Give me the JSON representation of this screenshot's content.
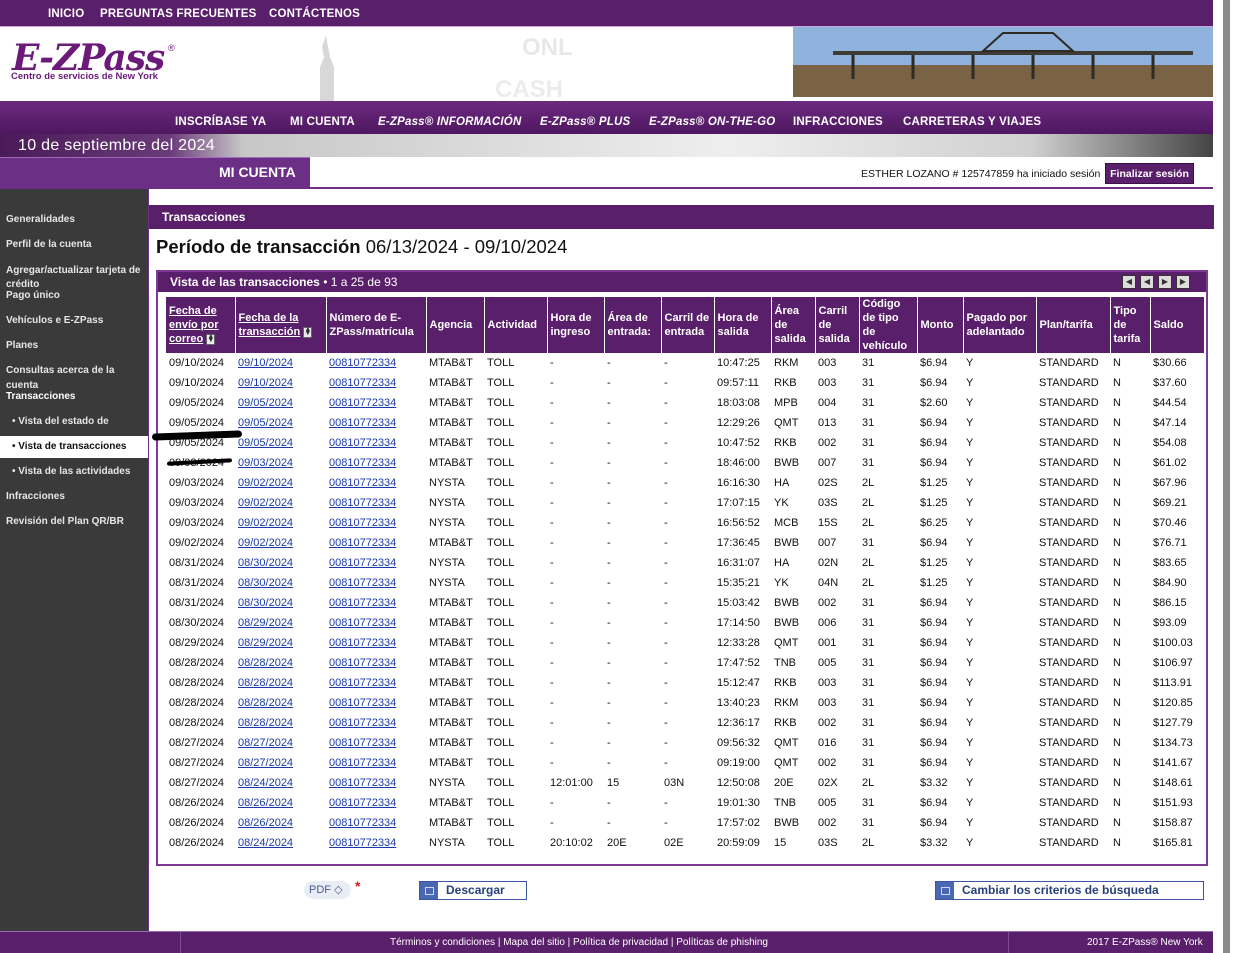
{
  "topnav": [
    "INICIO",
    "PREGUNTAS FRECUENTES",
    "CONTÁCTENOS"
  ],
  "logo": {
    "word": "E-ZPass",
    "reg": "®",
    "sub": "Centro de servicios de New York"
  },
  "mainnav": [
    "INSCRÍBASE YA",
    "MI CUENTA",
    "E-ZPass® INFORMACIÓN",
    "E-ZPass® PLUS",
    "E-ZPass® ON-THE-GO",
    "INFRACCIONES",
    "CARRETERAS Y VIAJES"
  ],
  "date": "10 de septiembre del 2024",
  "section_tab": "MI CUENTA",
  "user": {
    "line": "ESTHER LOZANO # 125747859 ha iniciado sesión",
    "logout": "Finalizar sesión"
  },
  "sidebar": {
    "generalidades": "Generalidades",
    "perfil": "Perfil de la cuenta",
    "tarjeta_1": "Agregar/actualizar tarjeta de",
    "tarjeta_2": "crédito",
    "pago": "Pago único",
    "vehiculos": "Vehículos e E-ZPass",
    "planes": "Planes",
    "consultas_1": "Consultas acerca de la",
    "consultas_2": "cuenta",
    "transacciones": "Transacciones",
    "estado": "• Vista del estado de",
    "vista_trans": "• Vista de transacciones",
    "actividades": "• Vista de las actividades",
    "infracciones": "Infracciones",
    "revision": "Revisión del Plan QR/BR"
  },
  "content": {
    "header": "Transacciones",
    "period_label": "Período de transacción",
    "period_range": "06/13/2024 - 09/10/2024",
    "panel_title": "Vista de las transacciones",
    "panel_range": "1 a 25 de 93"
  },
  "table": {
    "headers": [
      "Fecha de envío por correo",
      "Fecha de la transacción",
      "Número de E-ZPass/matrícula",
      "Agencia",
      "Actividad",
      "Hora de ingreso",
      "Área de entrada:",
      "Carril de entrada",
      "Hora de salida",
      "Área de salida",
      "Carril de salida",
      "Código de tipo de vehículo",
      "Monto",
      "Pagado por adelantado",
      "Plan/tarifa",
      "Tipo de tarifa",
      "Saldo"
    ],
    "rows": [
      [
        "09/10/2024",
        "09/10/2024",
        "00810772334",
        "MTAB&T",
        "TOLL",
        "-",
        "-",
        "-",
        "10:47:25",
        "RKM",
        "003",
        "31",
        "$6.94",
        "Y",
        "STANDARD",
        "N",
        "$30.66"
      ],
      [
        "09/10/2024",
        "09/10/2024",
        "00810772334",
        "MTAB&T",
        "TOLL",
        "-",
        "-",
        "-",
        "09:57:11",
        "RKB",
        "003",
        "31",
        "$6.94",
        "Y",
        "STANDARD",
        "N",
        "$37.60"
      ],
      [
        "09/05/2024",
        "09/05/2024",
        "00810772334",
        "MTAB&T",
        "TOLL",
        "-",
        "-",
        "-",
        "18:03:08",
        "MPB",
        "004",
        "31",
        "$2.60",
        "Y",
        "STANDARD",
        "N",
        "$44.54"
      ],
      [
        "09/05/2024",
        "09/05/2024",
        "00810772334",
        "MTAB&T",
        "TOLL",
        "-",
        "-",
        "-",
        "12:29:26",
        "QMT",
        "013",
        "31",
        "$6.94",
        "Y",
        "STANDARD",
        "N",
        "$47.14"
      ],
      [
        "09/05/2024",
        "09/05/2024",
        "00810772334",
        "MTAB&T",
        "TOLL",
        "-",
        "-",
        "-",
        "10:47:52",
        "RKB",
        "002",
        "31",
        "$6.94",
        "Y",
        "STANDARD",
        "N",
        "$54.08"
      ],
      [
        "09/03/2024",
        "09/03/2024",
        "00810772334",
        "MTAB&T",
        "TOLL",
        "-",
        "-",
        "-",
        "18:46:00",
        "BWB",
        "007",
        "31",
        "$6.94",
        "Y",
        "STANDARD",
        "N",
        "$61.02"
      ],
      [
        "09/03/2024",
        "09/02/2024",
        "00810772334",
        "NYSTA",
        "TOLL",
        "-",
        "-",
        "-",
        "16:16:30",
        "HA",
        "02S",
        "2L",
        "$1.25",
        "Y",
        "STANDARD",
        "N",
        "$67.96"
      ],
      [
        "09/03/2024",
        "09/02/2024",
        "00810772334",
        "NYSTA",
        "TOLL",
        "-",
        "-",
        "-",
        "17:07:15",
        "YK",
        "03S",
        "2L",
        "$1.25",
        "Y",
        "STANDARD",
        "N",
        "$69.21"
      ],
      [
        "09/03/2024",
        "09/02/2024",
        "00810772334",
        "NYSTA",
        "TOLL",
        "-",
        "-",
        "-",
        "16:56:52",
        "MCB",
        "15S",
        "2L",
        "$6.25",
        "Y",
        "STANDARD",
        "N",
        "$70.46"
      ],
      [
        "09/02/2024",
        "09/02/2024",
        "00810772334",
        "MTAB&T",
        "TOLL",
        "-",
        "-",
        "-",
        "17:36:45",
        "BWB",
        "007",
        "31",
        "$6.94",
        "Y",
        "STANDARD",
        "N",
        "$76.71"
      ],
      [
        "08/31/2024",
        "08/30/2024",
        "00810772334",
        "NYSTA",
        "TOLL",
        "-",
        "-",
        "-",
        "16:31:07",
        "HA",
        "02N",
        "2L",
        "$1.25",
        "Y",
        "STANDARD",
        "N",
        "$83.65"
      ],
      [
        "08/31/2024",
        "08/30/2024",
        "00810772334",
        "NYSTA",
        "TOLL",
        "-",
        "-",
        "-",
        "15:35:21",
        "YK",
        "04N",
        "2L",
        "$1.25",
        "Y",
        "STANDARD",
        "N",
        "$84.90"
      ],
      [
        "08/31/2024",
        "08/30/2024",
        "00810772334",
        "MTAB&T",
        "TOLL",
        "-",
        "-",
        "-",
        "15:03:42",
        "BWB",
        "002",
        "31",
        "$6.94",
        "Y",
        "STANDARD",
        "N",
        "$86.15"
      ],
      [
        "08/30/2024",
        "08/29/2024",
        "00810772334",
        "MTAB&T",
        "TOLL",
        "-",
        "-",
        "-",
        "17:14:50",
        "BWB",
        "006",
        "31",
        "$6.94",
        "Y",
        "STANDARD",
        "N",
        "$93.09"
      ],
      [
        "08/29/2024",
        "08/29/2024",
        "00810772334",
        "MTAB&T",
        "TOLL",
        "-",
        "-",
        "-",
        "12:33:28",
        "QMT",
        "001",
        "31",
        "$6.94",
        "Y",
        "STANDARD",
        "N",
        "$100.03"
      ],
      [
        "08/28/2024",
        "08/28/2024",
        "00810772334",
        "MTAB&T",
        "TOLL",
        "-",
        "-",
        "-",
        "17:47:52",
        "TNB",
        "005",
        "31",
        "$6.94",
        "Y",
        "STANDARD",
        "N",
        "$106.97"
      ],
      [
        "08/28/2024",
        "08/28/2024",
        "00810772334",
        "MTAB&T",
        "TOLL",
        "-",
        "-",
        "-",
        "15:12:47",
        "RKB",
        "003",
        "31",
        "$6.94",
        "Y",
        "STANDARD",
        "N",
        "$113.91"
      ],
      [
        "08/28/2024",
        "08/28/2024",
        "00810772334",
        "MTAB&T",
        "TOLL",
        "-",
        "-",
        "-",
        "13:40:23",
        "RKM",
        "003",
        "31",
        "$6.94",
        "Y",
        "STANDARD",
        "N",
        "$120.85"
      ],
      [
        "08/28/2024",
        "08/28/2024",
        "00810772334",
        "MTAB&T",
        "TOLL",
        "-",
        "-",
        "-",
        "12:36:17",
        "RKB",
        "002",
        "31",
        "$6.94",
        "Y",
        "STANDARD",
        "N",
        "$127.79"
      ],
      [
        "08/27/2024",
        "08/27/2024",
        "00810772334",
        "MTAB&T",
        "TOLL",
        "-",
        "-",
        "-",
        "09:56:32",
        "QMT",
        "016",
        "31",
        "$6.94",
        "Y",
        "STANDARD",
        "N",
        "$134.73"
      ],
      [
        "08/27/2024",
        "08/27/2024",
        "00810772334",
        "MTAB&T",
        "TOLL",
        "-",
        "-",
        "-",
        "09:19:00",
        "QMT",
        "002",
        "31",
        "$6.94",
        "Y",
        "STANDARD",
        "N",
        "$141.67"
      ],
      [
        "08/27/2024",
        "08/24/2024",
        "00810772334",
        "NYSTA",
        "TOLL",
        "12:01:00",
        "15",
        "03N",
        "12:50:08",
        "20E",
        "02X",
        "2L",
        "$3.32",
        "Y",
        "STANDARD",
        "N",
        "$148.61"
      ],
      [
        "08/26/2024",
        "08/26/2024",
        "00810772334",
        "MTAB&T",
        "TOLL",
        "-",
        "-",
        "-",
        "19:01:30",
        "TNB",
        "005",
        "31",
        "$6.94",
        "Y",
        "STANDARD",
        "N",
        "$151.93"
      ],
      [
        "08/26/2024",
        "08/26/2024",
        "00810772334",
        "MTAB&T",
        "TOLL",
        "-",
        "-",
        "-",
        "17:57:02",
        "BWB",
        "002",
        "31",
        "$6.94",
        "Y",
        "STANDARD",
        "N",
        "$158.87"
      ],
      [
        "08/26/2024",
        "08/24/2024",
        "00810772334",
        "NYSTA",
        "TOLL",
        "20:10:02",
        "20E",
        "02E",
        "20:59:09",
        "15",
        "03S",
        "2L",
        "$3.32",
        "Y",
        "STANDARD",
        "N",
        "$165.81"
      ]
    ]
  },
  "actions": {
    "format": "PDF",
    "format_arrow": "◇",
    "required": "*",
    "download": "Descargar",
    "change": "Cambiar los criterios de búsqueda"
  },
  "footer": {
    "links": "Términos y condiciones  |  Mapa del sitio  |  Política de privacidad  |  Políticas de phishing",
    "copyright": "2017 E-ZPass® New York"
  }
}
